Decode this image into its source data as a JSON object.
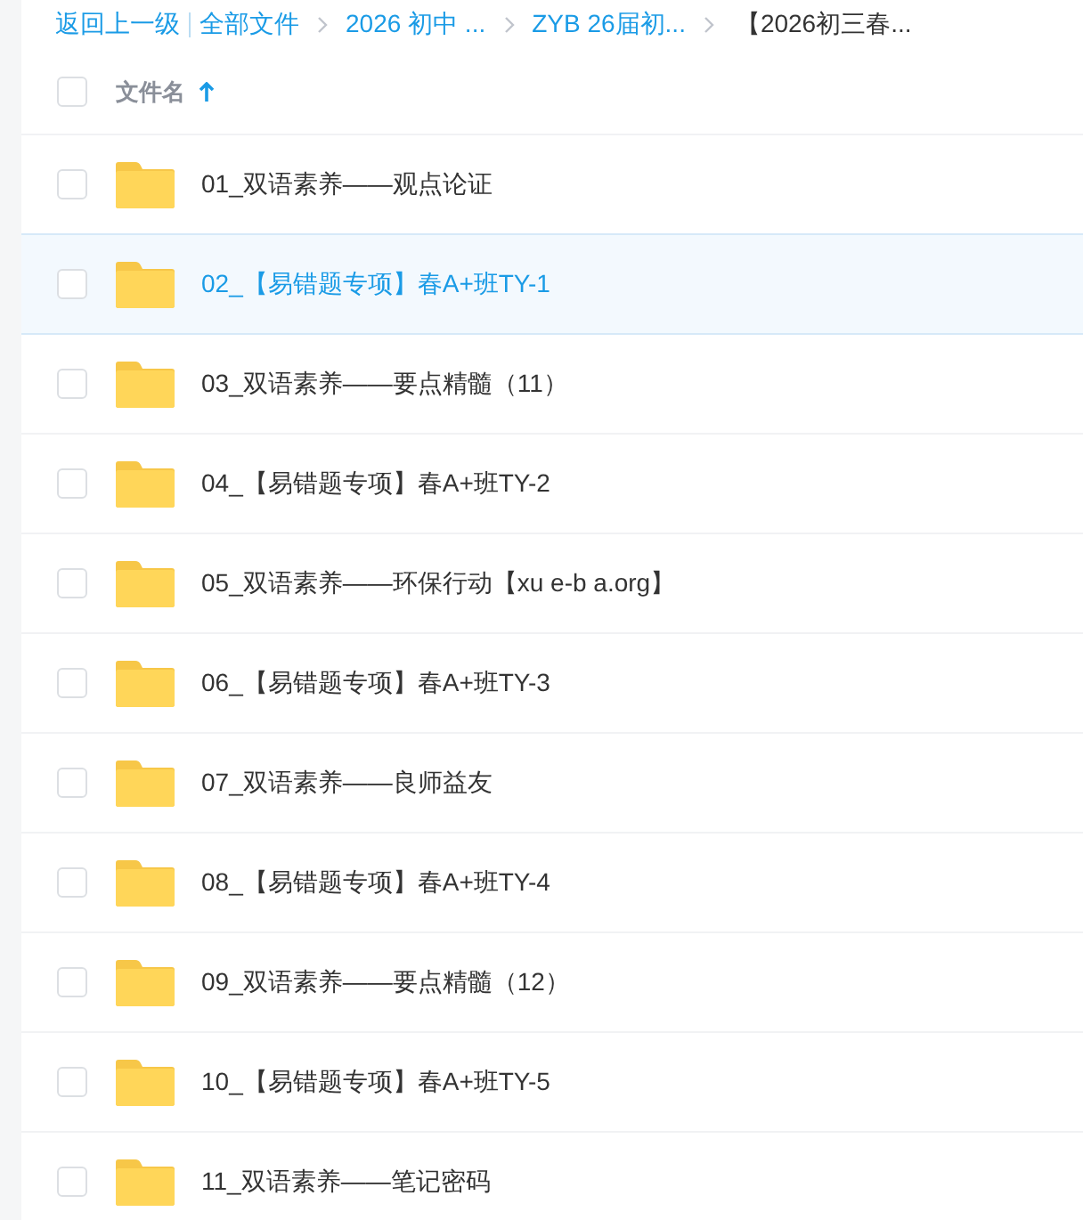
{
  "breadcrumb": {
    "back": "返回上一级",
    "items": [
      {
        "label": "全部文件",
        "current": false
      },
      {
        "label": "2026 初中 ...",
        "current": false
      },
      {
        "label": "ZYB 26届初...",
        "current": false
      },
      {
        "label": "【2026初三春...",
        "current": true
      }
    ]
  },
  "header": {
    "checked": false,
    "label": "文件名",
    "sorted": true
  },
  "rows": [
    {
      "name": "01_双语素养——观点论证",
      "checked": false,
      "hovered": false
    },
    {
      "name": "02_【易错题专项】春A+班TY-1",
      "checked": false,
      "hovered": true
    },
    {
      "name": "03_双语素养——要点精髓（11）",
      "checked": false,
      "hovered": false
    },
    {
      "name": "04_【易错题专项】春A+班TY-2",
      "checked": false,
      "hovered": false
    },
    {
      "name": "05_双语素养——环保行动【xu e-b a.org】",
      "checked": false,
      "hovered": false
    },
    {
      "name": "06_【易错题专项】春A+班TY-3",
      "checked": false,
      "hovered": false
    },
    {
      "name": "07_双语素养——良师益友",
      "checked": false,
      "hovered": false
    },
    {
      "name": "08_【易错题专项】春A+班TY-4",
      "checked": false,
      "hovered": false
    },
    {
      "name": "09_双语素养——要点精髓（12）",
      "checked": false,
      "hovered": false
    },
    {
      "name": "10_【易错题专项】春A+班TY-5",
      "checked": false,
      "hovered": false
    },
    {
      "name": "11_双语素养——笔记密码",
      "checked": false,
      "hovered": false
    }
  ]
}
